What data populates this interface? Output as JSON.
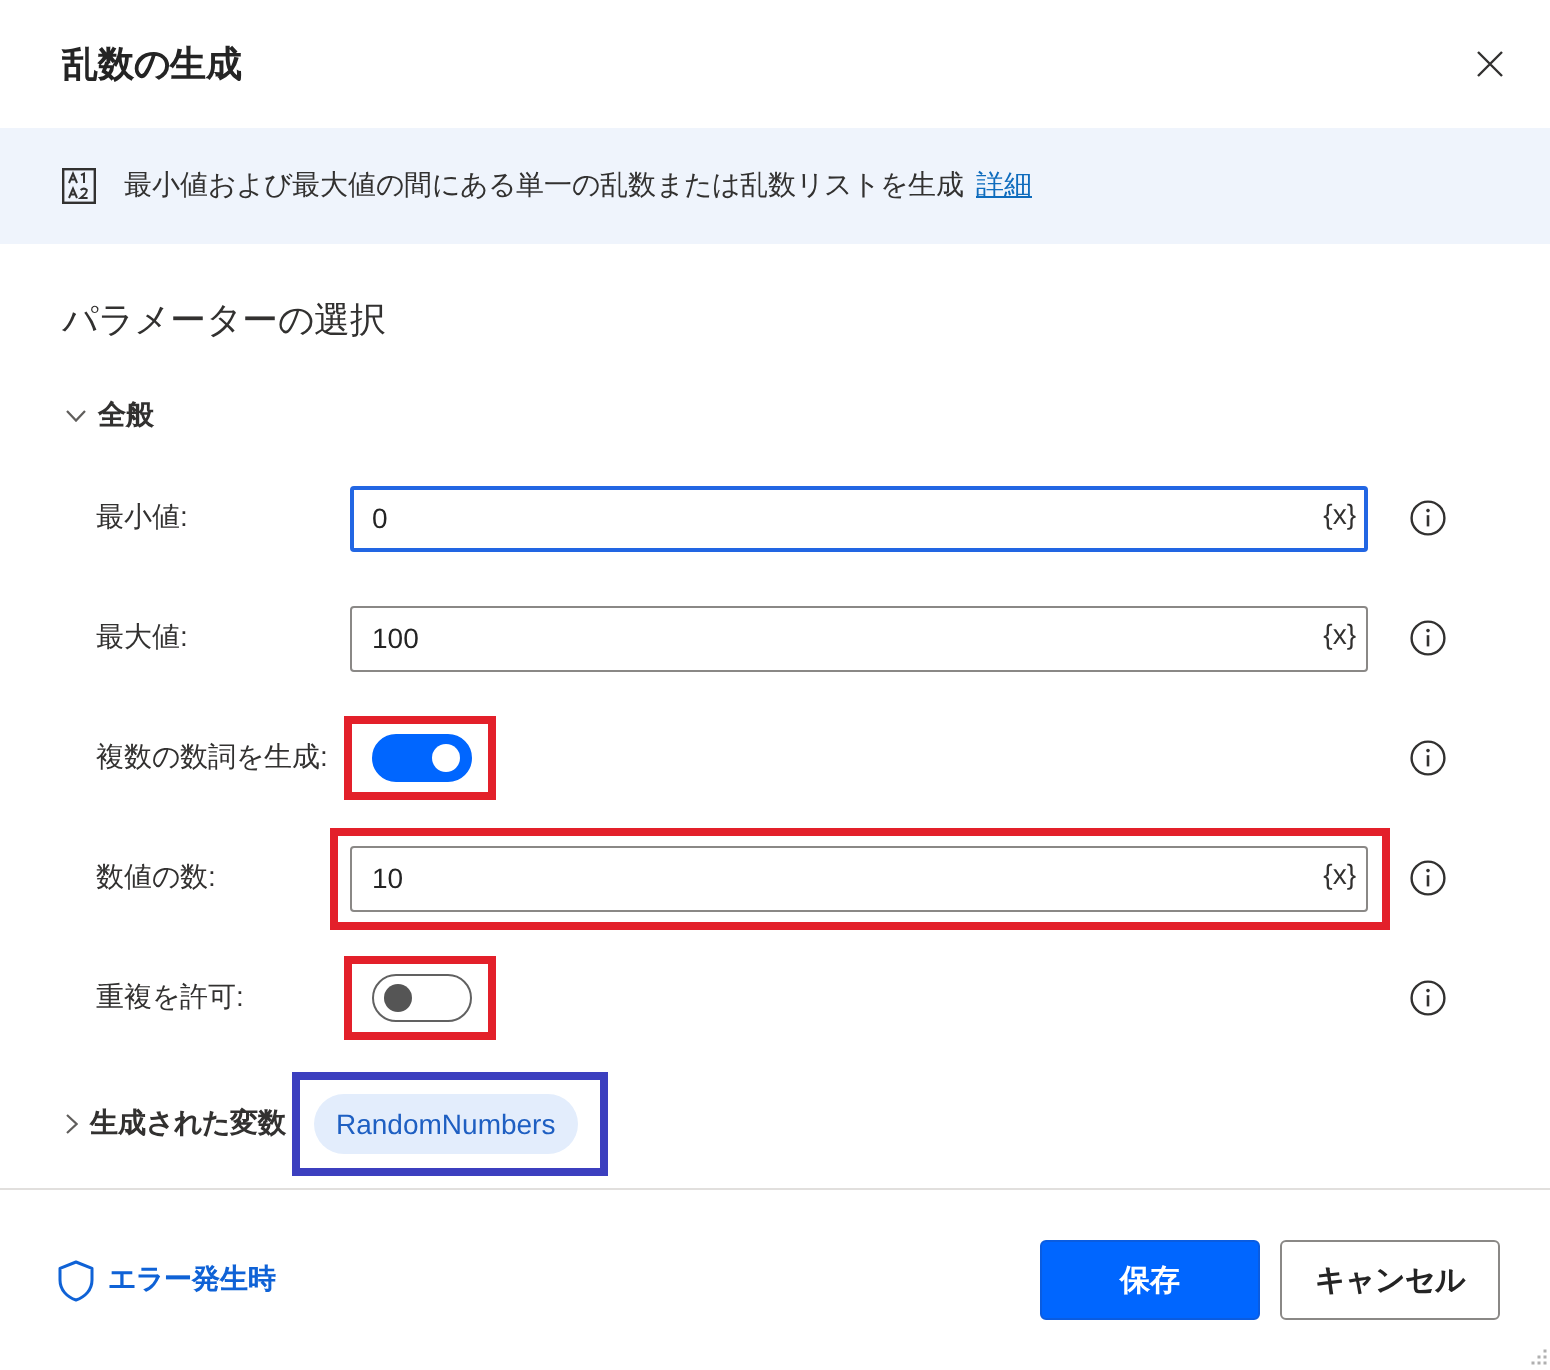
{
  "dialog": {
    "title": "乱数の生成"
  },
  "banner": {
    "description": "最小値および最大値の間にある単一の乱数または乱数リストを生成",
    "link": "詳細"
  },
  "parameters": {
    "heading": "パラメーターの選択",
    "section": {
      "title": "全般",
      "expanded": true,
      "fields": [
        {
          "kind": "text",
          "label": "最小値:",
          "value": "0",
          "variable_button": "{x}",
          "focused": true,
          "highlighted": false
        },
        {
          "kind": "text",
          "label": "最大値:",
          "value": "100",
          "variable_button": "{x}",
          "focused": false,
          "highlighted": false
        },
        {
          "kind": "toggle",
          "label": "複数の数詞を生成:",
          "on": true,
          "highlighted": true
        },
        {
          "kind": "text",
          "label": "数値の数:",
          "value": "10",
          "variable_button": "{x}",
          "focused": false,
          "highlighted": true
        },
        {
          "kind": "toggle",
          "label": "重複を許可:",
          "on": false,
          "highlighted": true
        }
      ]
    }
  },
  "produced_variables": {
    "title": "生成された変数",
    "expanded": false,
    "variables": [
      {
        "name": "RandomNumbers",
        "highlighted": true
      }
    ]
  },
  "footer": {
    "error_link": "エラー発生時",
    "buttons": [
      {
        "label": "保存",
        "kind": "primary"
      },
      {
        "label": "キャンセル",
        "kind": "secondary"
      }
    ]
  }
}
